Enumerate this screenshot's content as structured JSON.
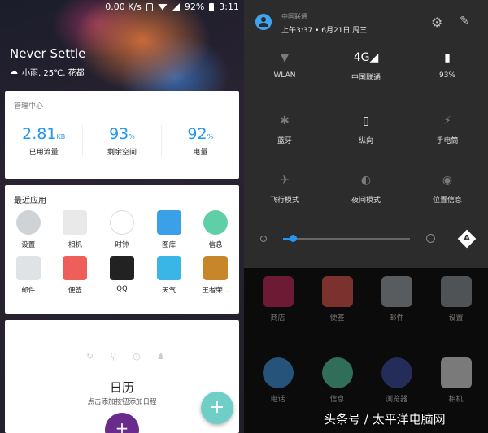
{
  "left_status": {
    "speed": "0.00 K/s",
    "battery": "92%",
    "time": "3:11"
  },
  "lockscreen": {
    "title": "Never Settle",
    "weather": "小雨, 25℃, 花都"
  },
  "management": {
    "title": "管理中心",
    "stats": [
      {
        "value": "2.81",
        "unit": "KB",
        "label": "已用流量"
      },
      {
        "value": "93",
        "unit": "%",
        "label": "剩余空间"
      },
      {
        "value": "92",
        "unit": "%",
        "label": "电量"
      }
    ]
  },
  "recent_apps": {
    "title": "最近应用",
    "apps": [
      {
        "label": "设置",
        "icon": "settings-icon",
        "color": "#cfd3d6"
      },
      {
        "label": "相机",
        "icon": "camera-icon",
        "color": "#e9e9e9"
      },
      {
        "label": "时钟",
        "icon": "clock-icon",
        "color": "#ffffff"
      },
      {
        "label": "图库",
        "icon": "gallery-icon",
        "color": "#3aa0e8"
      },
      {
        "label": "信息",
        "icon": "message-icon",
        "color": "#5fcfa8"
      },
      {
        "label": "邮件",
        "icon": "mail-icon",
        "color": "#dfe3e6"
      },
      {
        "label": "便签",
        "icon": "note-icon",
        "color": "#ee5e5a"
      },
      {
        "label": "QQ",
        "icon": "qq-icon",
        "color": "#222222"
      },
      {
        "label": "天气",
        "icon": "weather-icon",
        "color": "#39b6e6"
      },
      {
        "label": "王者荣...",
        "icon": "game-icon",
        "color": "#c7862a"
      }
    ]
  },
  "calendar": {
    "title": "日历",
    "subtitle": "点击添加按钮添加日程",
    "add": "+"
  },
  "notification_shade": {
    "carrier": "中国联通",
    "datetime": "上午3:37 • 6月21日 周三",
    "tiles": [
      {
        "label": "WLAN",
        "icon": "wifi-off-icon",
        "glyph": "▼"
      },
      {
        "label": "中国联通",
        "icon": "signal-4g-icon",
        "glyph": "4G◢"
      },
      {
        "label": "93%",
        "icon": "battery-icon",
        "glyph": "▮"
      },
      {
        "label": "蓝牙",
        "icon": "bluetooth-off-icon",
        "glyph": "✱"
      },
      {
        "label": "纵向",
        "icon": "portrait-icon",
        "glyph": "▯"
      },
      {
        "label": "手电筒",
        "icon": "flashlight-off-icon",
        "glyph": "⚡"
      },
      {
        "label": "飞行模式",
        "icon": "airplane-off-icon",
        "glyph": "✈"
      },
      {
        "label": "夜间模式",
        "icon": "night-mode-off-icon",
        "glyph": "◐"
      },
      {
        "label": "位置信息",
        "icon": "location-off-icon",
        "glyph": "◉"
      }
    ],
    "brightness": 0.08,
    "auto_brightness_label": "A"
  },
  "home_apps": [
    {
      "label": "商店",
      "color": "#c02a5a"
    },
    {
      "label": "便签",
      "color": "#d9534f"
    },
    {
      "label": "邮件",
      "color": "#9aa0a6"
    },
    {
      "label": "设置",
      "color": "#8a8f94"
    },
    {
      "label": "电话",
      "color": "#3b8fd6"
    },
    {
      "label": "信息",
      "color": "#4fbf9a"
    },
    {
      "label": "浏览器",
      "color": "#3a4a9a"
    },
    {
      "label": "相机",
      "color": "#d6d6d6"
    }
  ],
  "watermark": "头条号 / 太平洋电脑网"
}
